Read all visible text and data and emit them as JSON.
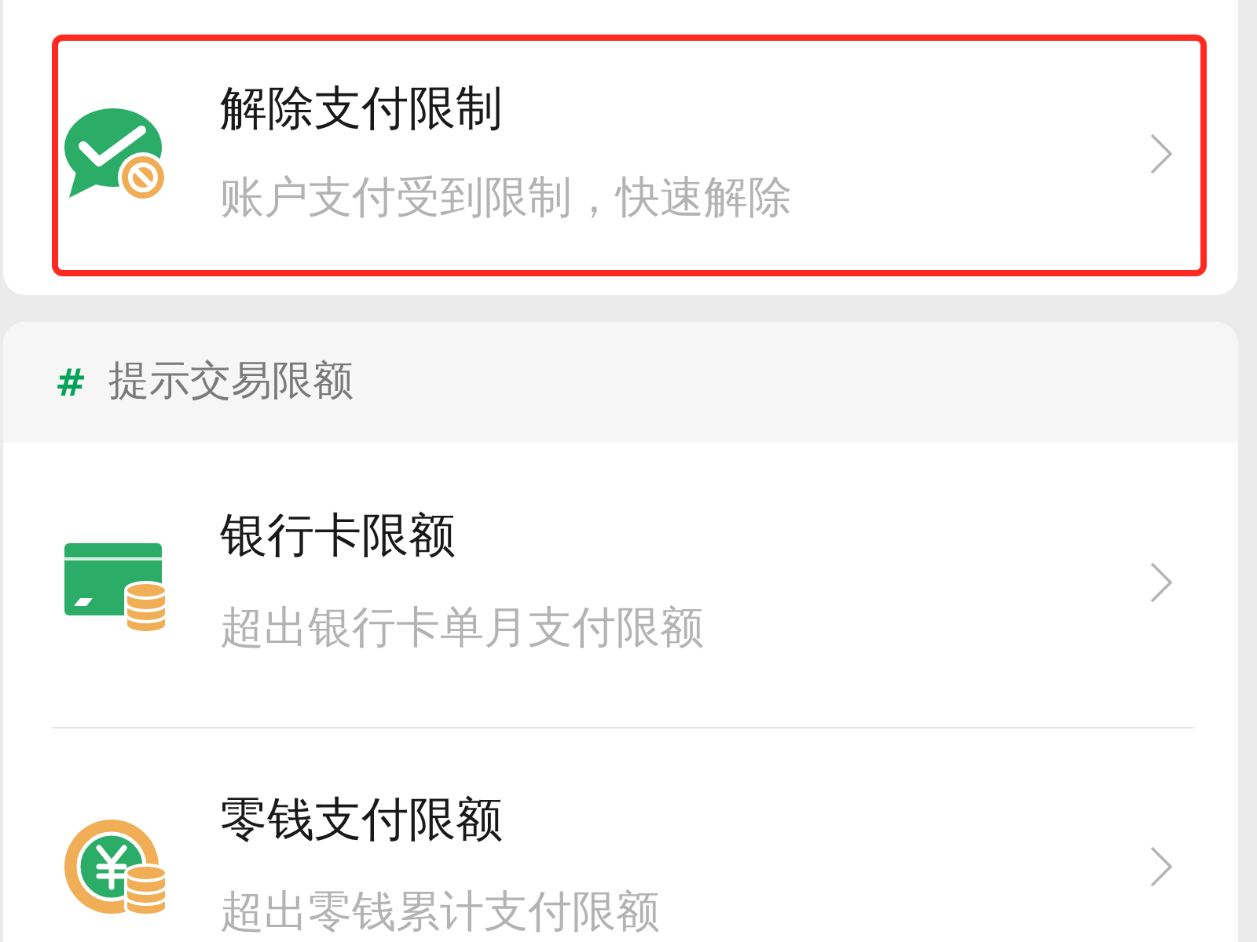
{
  "restriction": {
    "title": "解除支付限制",
    "subtitle": "账户支付受到限制，快速解除",
    "highlighted": true
  },
  "limits_section": {
    "marker": "#",
    "title": "提示交易限额",
    "items": [
      {
        "kind": "card",
        "title": "银行卡限额",
        "subtitle": "超出银行卡单月支付限额"
      },
      {
        "kind": "change",
        "title": "零钱支付限额",
        "subtitle": "超出零钱累计支付限额"
      }
    ]
  }
}
